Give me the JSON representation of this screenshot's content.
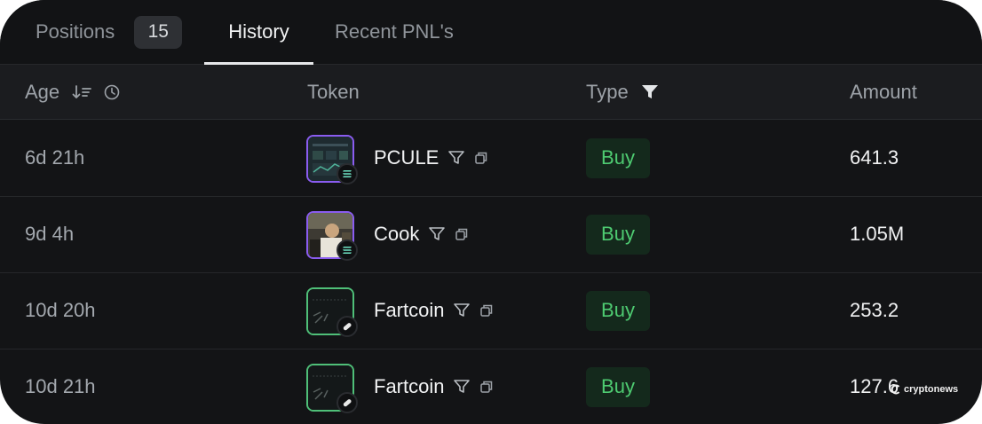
{
  "tabs": {
    "positions_label": "Positions",
    "positions_count": "15",
    "history_label": "History",
    "recent_label": "Recent PNL's"
  },
  "table": {
    "headers": {
      "age": "Age",
      "token": "Token",
      "type": "Type",
      "amount": "Amount"
    },
    "rows": [
      {
        "age": "6d 21h",
        "token": "PCULE",
        "token_icon": "pcule-token-icon",
        "chain_icon": "solana-icon",
        "type": "Buy",
        "amount": "641.3"
      },
      {
        "age": "9d 4h",
        "token": "Cook",
        "token_icon": "cook-token-icon",
        "chain_icon": "solana-icon",
        "type": "Buy",
        "amount": "1.05M"
      },
      {
        "age": "10d 20h",
        "token": "Fartcoin",
        "token_icon": "fartcoin-token-icon",
        "chain_icon": "pill-icon",
        "type": "Buy",
        "amount": "253.2"
      },
      {
        "age": "10d 21h",
        "token": "Fartcoin",
        "token_icon": "fartcoin-token-icon",
        "chain_icon": "pill-icon",
        "type": "Buy",
        "amount": "127.6"
      }
    ]
  },
  "watermark": "cryptonews",
  "colors": {
    "background": "#131416",
    "buy_text": "#4ecb71",
    "buy_bg": "#14291c",
    "active_tab": "#f2f3f4",
    "muted": "#8f949a"
  }
}
